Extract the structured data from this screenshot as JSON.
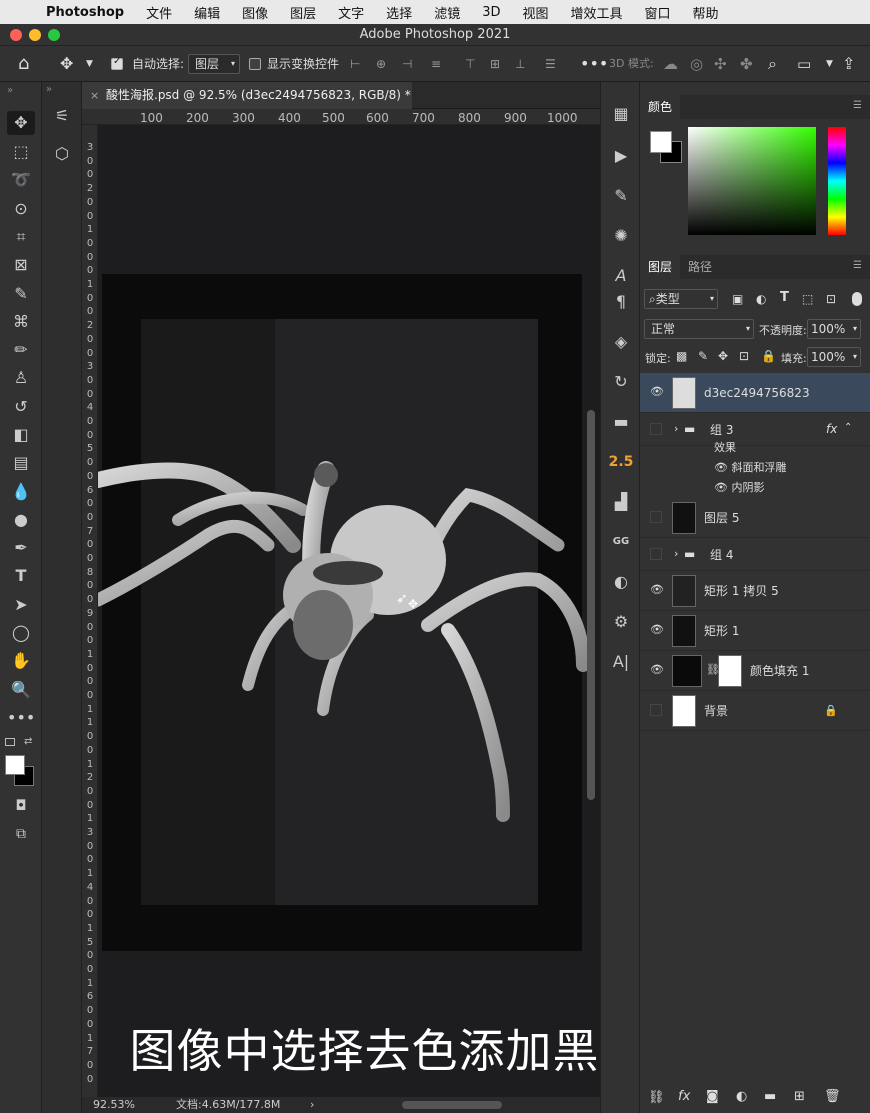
{
  "menubar": {
    "app": "Photoshop",
    "items": [
      "文件",
      "编辑",
      "图像",
      "图层",
      "文字",
      "选择",
      "滤镜",
      "3D",
      "视图",
      "增效工具",
      "窗口",
      "帮助"
    ]
  },
  "window": {
    "title": "Adobe Photoshop 2021"
  },
  "options": {
    "auto_select_label": "自动选择:",
    "auto_select_value": "图层",
    "show_transform_label": "显示变换控件",
    "mode_3d_label": "3D 模式:"
  },
  "document": {
    "tab_title": "酸性海报.psd @ 92.5% (d3ec2494756823, RGB/8) *",
    "ruler_h": [
      "100",
      "200",
      "300",
      "400",
      "500",
      "600",
      "700",
      "800",
      "900",
      "1000"
    ],
    "ruler_v": [
      "3",
      "0",
      "0",
      "2",
      "0",
      "0",
      "1",
      "0",
      "0",
      "0",
      "1",
      "0",
      "0",
      "2",
      "0",
      "0",
      "3",
      "0",
      "0",
      "4",
      "0",
      "0",
      "5",
      "0",
      "0",
      "6",
      "0",
      "0",
      "7",
      "0",
      "0",
      "8",
      "0",
      "0",
      "9",
      "0",
      "0",
      "1",
      "0",
      "0",
      "0",
      "1",
      "1",
      "0",
      "0",
      "1",
      "2",
      "0",
      "0",
      "1",
      "3",
      "0",
      "0",
      "1",
      "4",
      "0",
      "0",
      "1",
      "5",
      "0",
      "0",
      "1",
      "6",
      "0",
      "0",
      "1",
      "7",
      "0",
      "0"
    ]
  },
  "caption": "图像中选择去色添加黑白效果",
  "status": {
    "zoom": "92.53%",
    "doc_size": "文档:4.63M/177.8M",
    "arrow": "›"
  },
  "color_panel": {
    "tab": "颜色"
  },
  "layers_panel": {
    "tabs": [
      "图层",
      "路径"
    ],
    "filter_label": "类型",
    "blend_mode": "正常",
    "opacity_label": "不透明度:",
    "opacity_value": "100%",
    "lock_label": "锁定:",
    "fill_label": "填充:",
    "fill_value": "100%",
    "layers": [
      {
        "name": "d3ec2494756823",
        "visible": true
      },
      {
        "name": "组 3",
        "visible": false
      },
      {
        "name": "效果",
        "visible": false
      },
      {
        "name": "斜面和浮雕",
        "visible": true
      },
      {
        "name": "内阴影",
        "visible": true
      },
      {
        "name": "图层 5",
        "visible": false
      },
      {
        "name": "组 4",
        "visible": false
      },
      {
        "name": "矩形 1 拷贝 5",
        "visible": true
      },
      {
        "name": "矩形 1",
        "visible": true
      },
      {
        "name": "颜色填充 1",
        "visible": true
      },
      {
        "name": "背景",
        "visible": false
      }
    ],
    "fx_label": "fx",
    "strip_value": "2.5"
  },
  "colors": {
    "accent_orange": "#f0a030",
    "selected_layer": "#3a4a5c",
    "fg": "#ffffff",
    "bg": "#000000"
  }
}
